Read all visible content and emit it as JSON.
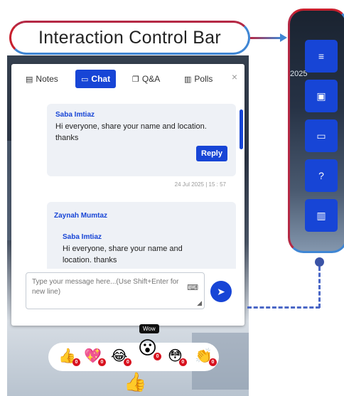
{
  "callout": {
    "label": "Interaction Control Bar"
  },
  "side_bar": {
    "background_text": "2025",
    "buttons": [
      {
        "icon": "menu-icon",
        "glyph": "≡"
      },
      {
        "icon": "notes-icon",
        "glyph": "▣"
      },
      {
        "icon": "chat-icon",
        "glyph": "▭"
      },
      {
        "icon": "question-icon",
        "glyph": "?"
      },
      {
        "icon": "polls-icon",
        "glyph": "▥"
      }
    ]
  },
  "tabs": [
    {
      "label": "Notes",
      "icon": "notes-icon",
      "glyph": "▤"
    },
    {
      "label": "Chat",
      "icon": "chat-icon",
      "glyph": "▭"
    },
    {
      "label": "Q&A",
      "icon": "qa-icon",
      "glyph": "❐"
    },
    {
      "label": "Polls",
      "icon": "polls-icon",
      "glyph": "▥"
    }
  ],
  "active_tab": "Chat",
  "messages": [
    {
      "author": "Saba Imtiaz",
      "text_line1": "Hi everyone, share your name and location.",
      "text_line2": "thanks",
      "reply_label": "Reply",
      "timestamp": "24 Jul 2025 | 15 : 57"
    },
    {
      "author": "Zaynah Mumtaz",
      "quoted_author": "Saba Imtiaz",
      "quoted_line1": "Hi everyone, share your name and",
      "quoted_line2": "location. thanks"
    }
  ],
  "composer": {
    "placeholder": "Type your message here...(Use Shift+Enter for new line)"
  },
  "reactions": {
    "hover_label": "Wow",
    "items": [
      {
        "emoji": "👍",
        "count": "0"
      },
      {
        "emoji": "💖",
        "count": "0"
      },
      {
        "emoji": "😂",
        "count": "0"
      },
      {
        "emoji": "😮",
        "count": "0"
      },
      {
        "emoji": "😳",
        "count": "0"
      },
      {
        "emoji": "👏",
        "count": "0"
      }
    ],
    "floating": "👍"
  },
  "colors": {
    "accent": "#1745d6",
    "callout_red": "#c8202e",
    "callout_blue": "#3f86d4",
    "badge_red": "#d8121f"
  }
}
